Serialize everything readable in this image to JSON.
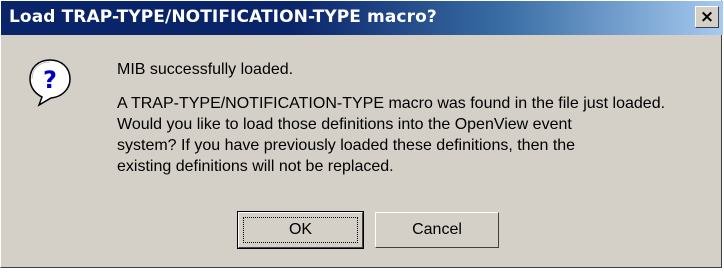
{
  "window": {
    "title": "Load TRAP-TYPE/NOTIFICATION-TYPE macro?",
    "close_glyph": "×",
    "title_bar_color": "#0a246a"
  },
  "icon": {
    "name": "question-icon",
    "glyph": "?"
  },
  "message": {
    "primary": "MIB successfully loaded.",
    "lines": [
      "A TRAP-TYPE/NOTIFICATION-TYPE macro was found in the file just loaded.",
      "Would you like to load those definitions into the OpenView event",
      "system?  If you have previously loaded these definitions, then the",
      "existing definitions will not be replaced."
    ]
  },
  "buttons": {
    "ok_label": "OK",
    "cancel_label": "Cancel"
  }
}
